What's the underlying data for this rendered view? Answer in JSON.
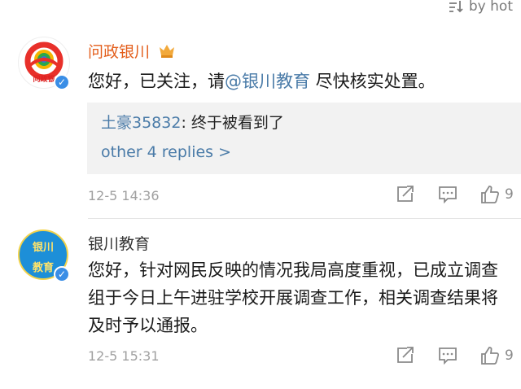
{
  "sort": {
    "label": "by hot"
  },
  "comments": [
    {
      "username": "问政银川",
      "avatar_text": "问政银",
      "text_prefix": "您好，已关注，请",
      "mention": "@银川教育",
      "text_suffix": " 尽快核实处置。",
      "reply": {
        "user": "土豪35832",
        "text": ": 终于被看到了"
      },
      "more_replies": "other 4 replies >",
      "time": "12-5 14:36",
      "likes": "9"
    },
    {
      "username": "银川教育",
      "avatar_text_top": "银川",
      "avatar_text_bottom": "教育",
      "text": "您好，针对网民反映的情况我局高度重视，已成立调查组于今日上午进驻学校开展调查工作，相关调查结果将及时予以通报。",
      "time": "12-5 15:31",
      "likes": "9"
    }
  ],
  "colors": {
    "link": "#4a7ba8",
    "username": "#e35d1a",
    "meta": "#a0a0a0",
    "verified": "#3a8ee6"
  }
}
